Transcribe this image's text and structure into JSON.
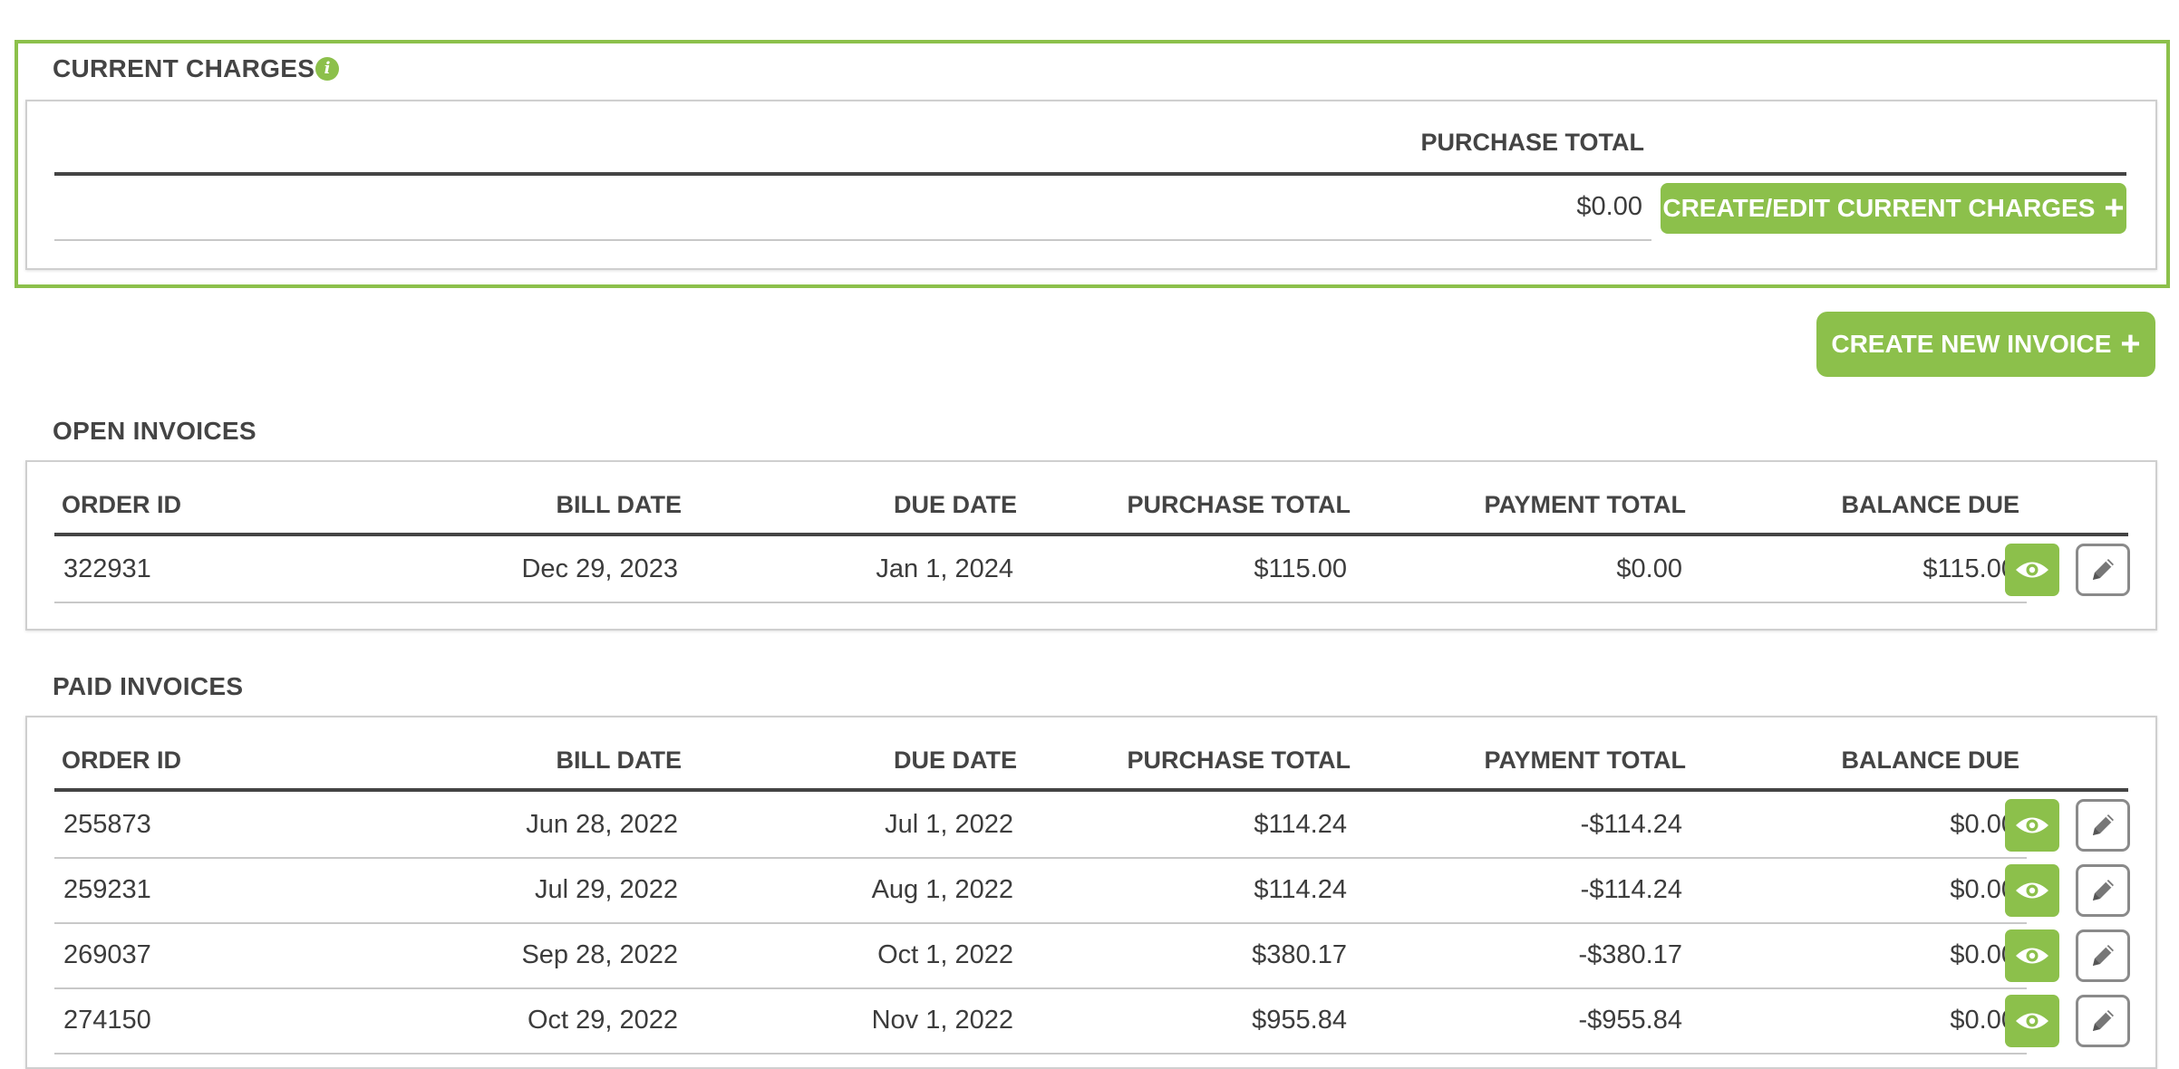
{
  "current_charges": {
    "title": "CURRENT CHARGES",
    "info_icon": "info-icon",
    "column_header": "PURCHASE TOTAL",
    "purchase_total": "$0.00",
    "button_label": "CREATE/EDIT CURRENT CHARGES",
    "button_icon": "plus-icon"
  },
  "create_invoice": {
    "button_label": "CREATE NEW INVOICE",
    "button_icon": "plus-icon"
  },
  "columns": [
    "ORDER ID",
    "BILL DATE",
    "DUE DATE",
    "PURCHASE TOTAL",
    "PAYMENT TOTAL",
    "BALANCE DUE"
  ],
  "open_invoices": {
    "title": "OPEN INVOICES",
    "rows": [
      {
        "order_id": "322931",
        "bill_date": "Dec 29, 2023",
        "due_date": "Jan 1, 2024",
        "purchase_total": "$115.00",
        "payment_total": "$0.00",
        "balance_due": "$115.00"
      }
    ]
  },
  "paid_invoices": {
    "title": "PAID INVOICES",
    "rows": [
      {
        "order_id": "255873",
        "bill_date": "Jun 28, 2022",
        "due_date": "Jul 1, 2022",
        "purchase_total": "$114.24",
        "payment_total": "-$114.24",
        "balance_due": "$0.00"
      },
      {
        "order_id": "259231",
        "bill_date": "Jul 29, 2022",
        "due_date": "Aug 1, 2022",
        "purchase_total": "$114.24",
        "payment_total": "-$114.24",
        "balance_due": "$0.00"
      },
      {
        "order_id": "269037",
        "bill_date": "Sep 28, 2022",
        "due_date": "Oct 1, 2022",
        "purchase_total": "$380.17",
        "payment_total": "-$380.17",
        "balance_due": "$0.00"
      },
      {
        "order_id": "274150",
        "bill_date": "Oct 29, 2022",
        "due_date": "Nov 1, 2022",
        "purchase_total": "$955.84",
        "payment_total": "-$955.84",
        "balance_due": "$0.00"
      }
    ]
  },
  "row_actions": {
    "view_icon": "eye-icon",
    "edit_icon": "pencil-icon"
  },
  "colors": {
    "accent": "#8cc04b",
    "text": "#3c3c3c",
    "rule": "#444444"
  }
}
